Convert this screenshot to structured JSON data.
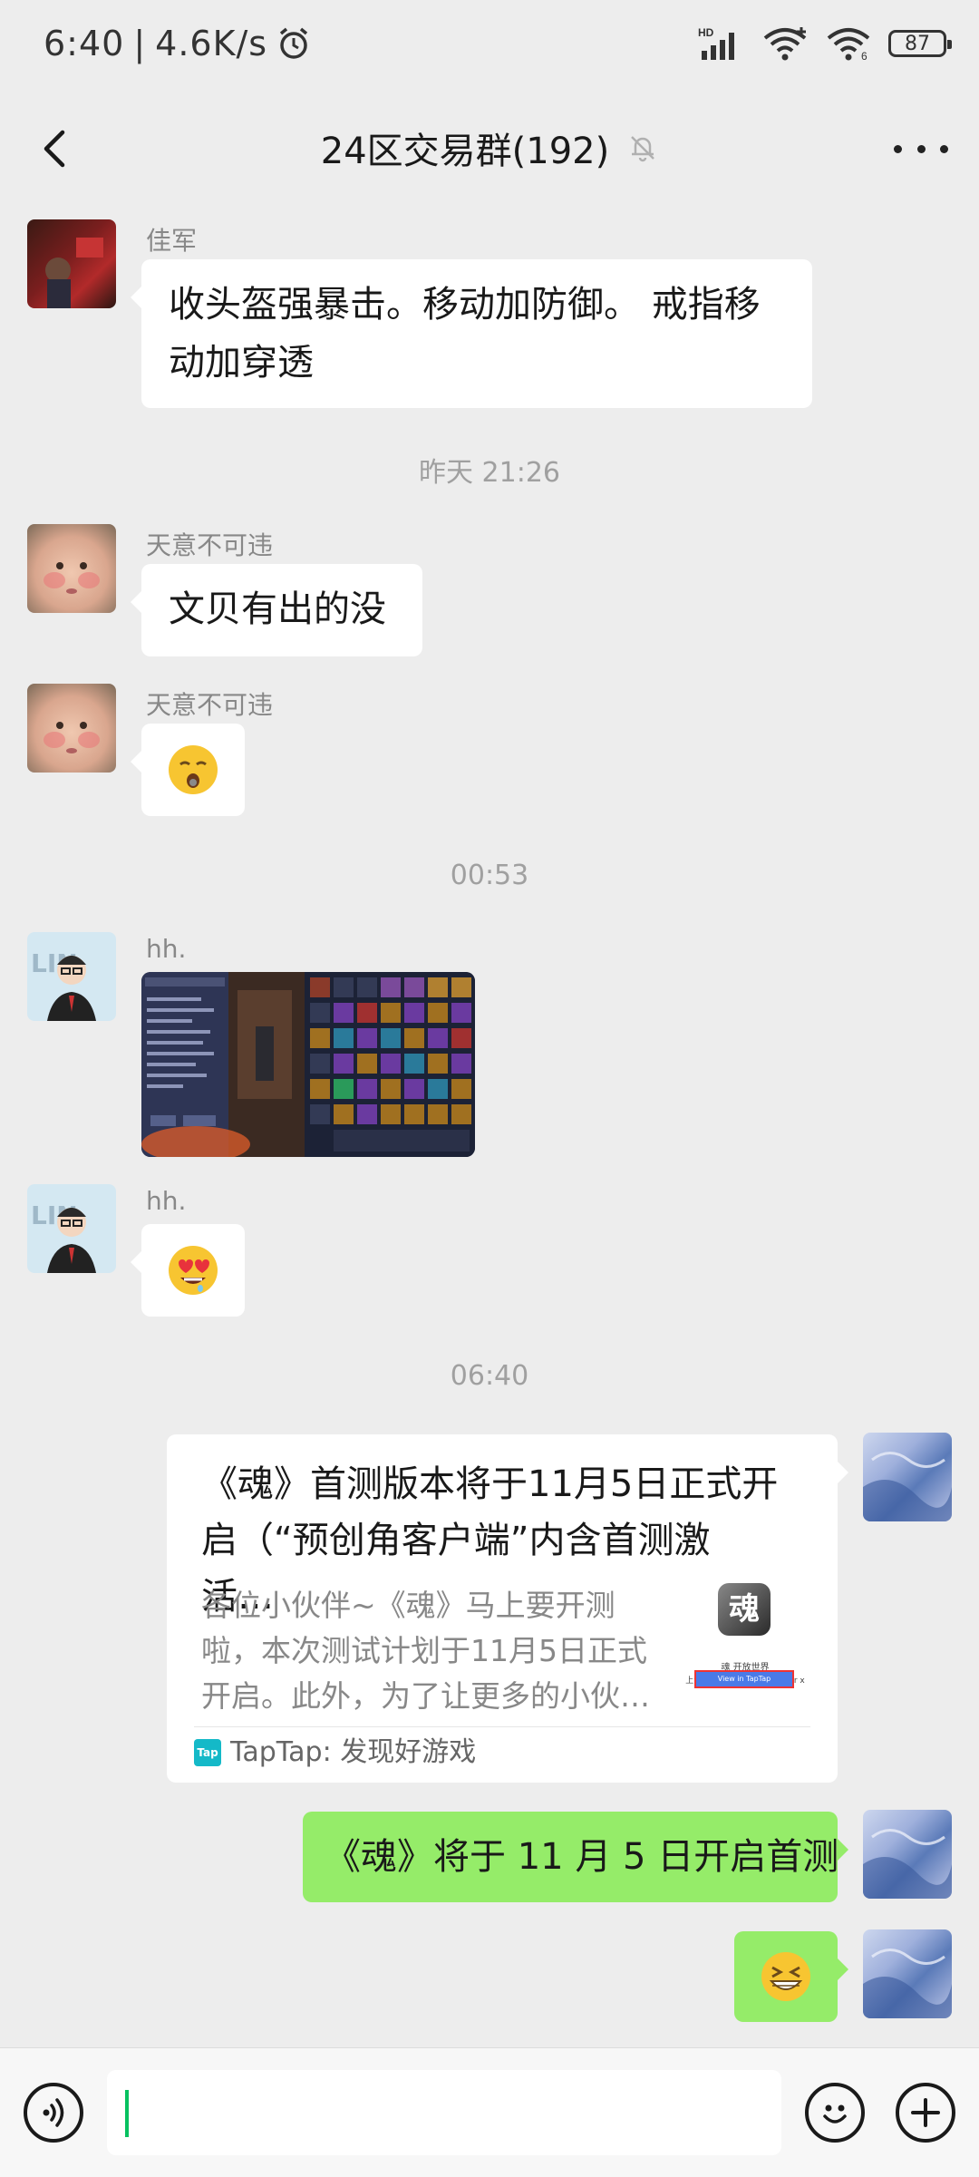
{
  "status_bar": {
    "time": "6:40",
    "net_speed": "4.6K/s",
    "battery": "87",
    "hd_label": "HD",
    "sim_label": "6"
  },
  "header": {
    "title": "24区交易群(192)"
  },
  "messages": [
    {
      "sender": "佳军",
      "text_line1": "收头盔强暴击。移动加防御。 戒指移",
      "text_line2": "动加穿透"
    },
    {
      "time": "昨天 21:26"
    },
    {
      "sender": "天意不可违",
      "text": "文贝有出的没"
    },
    {
      "sender": "天意不可违",
      "emoji": "hushed-face-emoji"
    },
    {
      "time": "00:53"
    },
    {
      "sender": "hh.",
      "image": "game-inventory-screenshot"
    },
    {
      "sender": "hh.",
      "emoji": "heart-eyes-emoji"
    },
    {
      "time": "06:40"
    }
  ],
  "share_card": {
    "title_line1": "《魂》首测版本将于11月5日正式开",
    "title_line2": "启（“预创角客户端”内含首测激活…",
    "desc_line1": "各位小伙伴~《魂》马上要开测",
    "desc_line2": "啦，本次测试计划于11月5日正式",
    "desc_line3": "开启。此外，为了让更多的小伙…",
    "thumb_caption1": "魂 开放世界",
    "thumb_caption2": "上海网易互娱科技有限公司 for x",
    "thumb_button": "View in TapTap",
    "source": "TapTap: 发现好游戏",
    "source_logo": "Tap"
  },
  "my_messages": {
    "text": "《魂》将于 11 月 5 日开启首测",
    "emoji": "grinning-squinting-emoji"
  },
  "colors": {
    "background": "#ededed",
    "green_bubble": "#95ec69",
    "cursor": "#07c160"
  }
}
